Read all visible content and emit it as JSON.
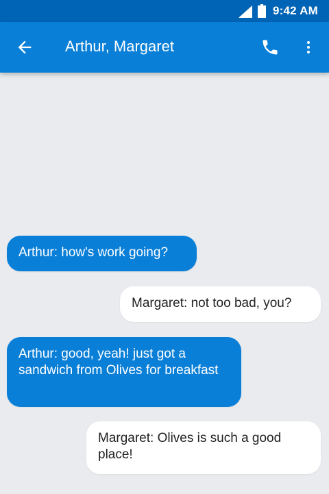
{
  "status_bar": {
    "time": "9:42 AM",
    "icons": [
      "signal-icon",
      "battery-icon"
    ]
  },
  "app_bar": {
    "title": "Arthur, Margaret",
    "icons": {
      "back": "arrow-back-icon",
      "call": "phone-icon",
      "more": "more-vert-icon"
    }
  },
  "colors": {
    "status_bar_bg": "#0064b6",
    "app_bar_bg": "#0a7fd7",
    "incoming_bubble": "#0a7fd7",
    "outgoing_bubble": "#ffffff",
    "background": "#e9ebee"
  },
  "messages": [
    {
      "direction": "incoming",
      "text": "Arthur: how's work going?"
    },
    {
      "direction": "outgoing",
      "text": "Margaret: not too bad, you?"
    },
    {
      "direction": "incoming",
      "text": "Arthur: good, yeah! just got a sandwich from Olives for breakfast"
    },
    {
      "direction": "outgoing",
      "text": "Margaret: Olives is such a good place!"
    }
  ]
}
